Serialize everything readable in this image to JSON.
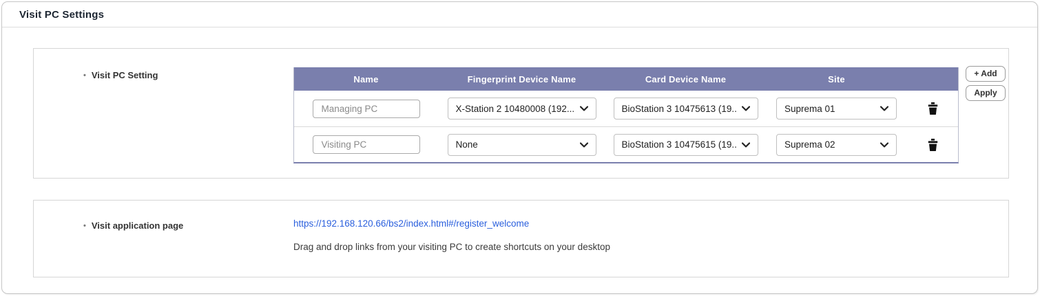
{
  "page": {
    "title": "Visit PC Settings"
  },
  "visit_pc_setting": {
    "label": "Visit PC Setting",
    "table": {
      "columns": [
        "Name",
        "Fingerprint Device Name",
        "Card Device Name",
        "Site"
      ],
      "rows": [
        {
          "name": "Managing PC",
          "fingerprint_device": "X-Station 2 10480008 (192...",
          "card_device": "BioStation 3 10475613 (19...",
          "site": "Suprema 01"
        },
        {
          "name": "Visiting PC",
          "fingerprint_device": "None",
          "card_device": "BioStation 3 10475615 (19...",
          "site": "Suprema 02"
        }
      ]
    },
    "buttons": {
      "add": "+ Add",
      "apply": "Apply"
    }
  },
  "visit_application_page": {
    "label": "Visit application page",
    "link": "https://192.168.120.66/bs2/index.html#/register_welcome",
    "description": "Drag and drop links from your visiting PC to create shortcuts on your desktop"
  },
  "colors": {
    "table_header_bg": "#7a7fad",
    "table_bottom_border": "#7a7fad",
    "link": "#2a5fdd",
    "title_text": "#1c2531"
  }
}
